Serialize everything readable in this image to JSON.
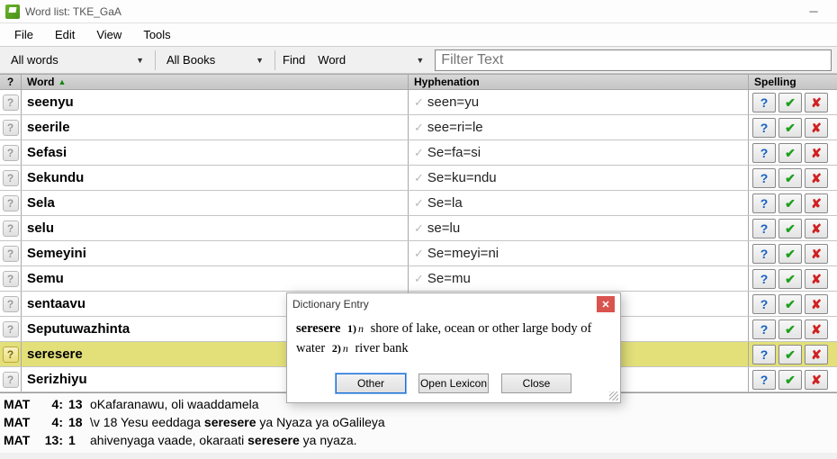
{
  "window": {
    "title": "Word list: TKE_GaA"
  },
  "menu": {
    "file": "File",
    "edit": "Edit",
    "view": "View",
    "tools": "Tools"
  },
  "toolbar": {
    "filter1": "All words",
    "filter2": "All Books",
    "find_label": "Find",
    "find_mode": "Word",
    "filter_placeholder": "Filter Text"
  },
  "headers": {
    "q": "?",
    "word": "Word",
    "hyph": "Hyphenation",
    "spell": "Spelling"
  },
  "rows": [
    {
      "word": "seenyu",
      "hyph": "seen=yu"
    },
    {
      "word": "seerile",
      "hyph": "see=ri=le"
    },
    {
      "word": "Sefasi",
      "hyph": "Se=fa=si"
    },
    {
      "word": "Sekundu",
      "hyph": "Se=ku=ndu"
    },
    {
      "word": "Sela",
      "hyph": "Se=la"
    },
    {
      "word": "selu",
      "hyph": "se=lu"
    },
    {
      "word": "Semeyini",
      "hyph": "Se=meyi=ni"
    },
    {
      "word": "Semu",
      "hyph": "Se=mu"
    },
    {
      "word": "sentaavu",
      "hyph": ""
    },
    {
      "word": "Seputuwazhinta",
      "hyph": ""
    },
    {
      "word": "seresere",
      "hyph": "",
      "selected": true
    },
    {
      "word": "Serizhiyu",
      "hyph": ""
    }
  ],
  "dialog": {
    "title": "Dictionary Entry",
    "headword": "seresere",
    "sense1_num": "1)",
    "sense1_ps": "n",
    "sense1_def": "shore of lake, ocean or other large body of water",
    "sense2_num": "2)",
    "sense2_ps": "n",
    "sense2_def": "river bank",
    "btn_other": "Other",
    "btn_lex": "Open Lexicon",
    "btn_close": "Close"
  },
  "refs": [
    {
      "bk": "MAT",
      "ch": "4:",
      "vs": "13",
      "text_pre": "oKafaranawu, oli waaddamela",
      "text_bold": "",
      "text_post": ""
    },
    {
      "bk": "MAT",
      "ch": "4:",
      "vs": "18",
      "text_pre": "\\v 18 Yesu eeddaga ",
      "text_bold": "seresere",
      "text_post": " ya Nyaza ya oGalileya"
    },
    {
      "bk": "MAT",
      "ch": "13:",
      "vs": "1",
      "text_pre": "ahivenyaga vaade, okaraati ",
      "text_bold": "seresere",
      "text_post": " ya nyaza."
    }
  ]
}
